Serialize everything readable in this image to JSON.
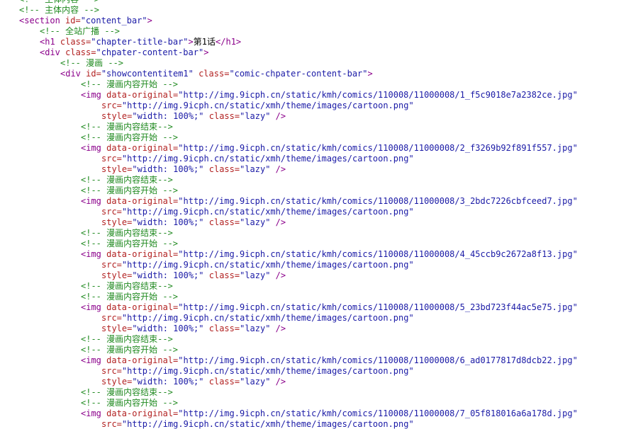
{
  "colors": {
    "comment": "#228b22",
    "tag": "#8b008b",
    "attribute": "#b22222",
    "value": "#1a1aa6",
    "text": "#000000",
    "background": "#ffffff"
  },
  "lines": [
    {
      "indent": 1,
      "tokens": [
        {
          "k": "c",
          "s": "<!-- 主体内容 -->"
        }
      ]
    },
    {
      "indent": 1,
      "tokens": [
        {
          "k": "c",
          "s": "<!-- 主体内容 -->"
        }
      ]
    },
    {
      "indent": 1,
      "tokens": [
        {
          "k": "t",
          "s": "<section"
        },
        {
          "k": "a",
          "s": " id="
        },
        {
          "k": "v",
          "s": "\"content_bar\""
        },
        {
          "k": "t",
          "s": ">"
        }
      ]
    },
    {
      "indent": 2,
      "tokens": [
        {
          "k": "c",
          "s": "<!-- 全站广播 -->"
        }
      ]
    },
    {
      "indent": 2,
      "tokens": [
        {
          "k": "t",
          "s": "<h1"
        },
        {
          "k": "a",
          "s": " class="
        },
        {
          "k": "v",
          "s": "\"chapter-title-bar\""
        },
        {
          "k": "t",
          "s": ">"
        },
        {
          "k": "x",
          "s": "第1话"
        },
        {
          "k": "t",
          "s": "</h1>"
        }
      ]
    },
    {
      "indent": 2,
      "tokens": [
        {
          "k": "t",
          "s": "<div"
        },
        {
          "k": "a",
          "s": " class="
        },
        {
          "k": "v",
          "s": "\"chpater-content-bar\""
        },
        {
          "k": "t",
          "s": ">"
        }
      ]
    },
    {
      "indent": 3,
      "tokens": [
        {
          "k": "c",
          "s": "<!-- 漫画 -->"
        }
      ]
    },
    {
      "indent": 3,
      "tokens": [
        {
          "k": "t",
          "s": "<div"
        },
        {
          "k": "a",
          "s": " id="
        },
        {
          "k": "v",
          "s": "\"showcontentitem1\""
        },
        {
          "k": "a",
          "s": " class="
        },
        {
          "k": "v",
          "s": "\"comic-chpater-content-bar\""
        },
        {
          "k": "t",
          "s": ">"
        }
      ]
    },
    {
      "indent": 4,
      "tokens": [
        {
          "k": "c",
          "s": "<!-- 漫画内容开始 -->"
        }
      ]
    },
    {
      "indent": 4,
      "tokens": [
        {
          "k": "t",
          "s": "<img"
        },
        {
          "k": "a",
          "s": " data-original="
        },
        {
          "k": "v",
          "s": "\"http://img.9icph.cn/static/kmh/comics/110008/11000008/1_f5c9018e7a2382ce.jpg\""
        }
      ]
    },
    {
      "indent": 5,
      "tokens": [
        {
          "k": "a",
          "s": "src="
        },
        {
          "k": "v",
          "s": "\"http://img.9icph.cn/static/xmh/theme/images/cartoon.png\""
        }
      ]
    },
    {
      "indent": 5,
      "tokens": [
        {
          "k": "a",
          "s": "style="
        },
        {
          "k": "v",
          "s": "\"width: 100%;\""
        },
        {
          "k": "a",
          "s": " class="
        },
        {
          "k": "v",
          "s": "\"lazy\""
        },
        {
          "k": "t",
          "s": " />"
        }
      ]
    },
    {
      "indent": 4,
      "tokens": [
        {
          "k": "c",
          "s": "<!-- 漫画内容结束-->"
        }
      ]
    },
    {
      "indent": 4,
      "tokens": [
        {
          "k": "c",
          "s": "<!-- 漫画内容开始 -->"
        }
      ]
    },
    {
      "indent": 4,
      "tokens": [
        {
          "k": "t",
          "s": "<img"
        },
        {
          "k": "a",
          "s": " data-original="
        },
        {
          "k": "v",
          "s": "\"http://img.9icph.cn/static/kmh/comics/110008/11000008/2_f3269b92f891f557.jpg\""
        }
      ]
    },
    {
      "indent": 5,
      "tokens": [
        {
          "k": "a",
          "s": "src="
        },
        {
          "k": "v",
          "s": "\"http://img.9icph.cn/static/xmh/theme/images/cartoon.png\""
        }
      ]
    },
    {
      "indent": 5,
      "tokens": [
        {
          "k": "a",
          "s": "style="
        },
        {
          "k": "v",
          "s": "\"width: 100%;\""
        },
        {
          "k": "a",
          "s": " class="
        },
        {
          "k": "v",
          "s": "\"lazy\""
        },
        {
          "k": "t",
          "s": " />"
        }
      ]
    },
    {
      "indent": 4,
      "tokens": [
        {
          "k": "c",
          "s": "<!-- 漫画内容结束-->"
        }
      ]
    },
    {
      "indent": 4,
      "tokens": [
        {
          "k": "c",
          "s": "<!-- 漫画内容开始 -->"
        }
      ]
    },
    {
      "indent": 4,
      "tokens": [
        {
          "k": "t",
          "s": "<img"
        },
        {
          "k": "a",
          "s": " data-original="
        },
        {
          "k": "v",
          "s": "\"http://img.9icph.cn/static/kmh/comics/110008/11000008/3_2bdc7226cbfceed7.jpg\""
        }
      ]
    },
    {
      "indent": 5,
      "tokens": [
        {
          "k": "a",
          "s": "src="
        },
        {
          "k": "v",
          "s": "\"http://img.9icph.cn/static/xmh/theme/images/cartoon.png\""
        }
      ]
    },
    {
      "indent": 5,
      "tokens": [
        {
          "k": "a",
          "s": "style="
        },
        {
          "k": "v",
          "s": "\"width: 100%;\""
        },
        {
          "k": "a",
          "s": " class="
        },
        {
          "k": "v",
          "s": "\"lazy\""
        },
        {
          "k": "t",
          "s": " />"
        }
      ]
    },
    {
      "indent": 4,
      "tokens": [
        {
          "k": "c",
          "s": "<!-- 漫画内容结束-->"
        }
      ]
    },
    {
      "indent": 4,
      "tokens": [
        {
          "k": "c",
          "s": "<!-- 漫画内容开始 -->"
        }
      ]
    },
    {
      "indent": 4,
      "tokens": [
        {
          "k": "t",
          "s": "<img"
        },
        {
          "k": "a",
          "s": " data-original="
        },
        {
          "k": "v",
          "s": "\"http://img.9icph.cn/static/kmh/comics/110008/11000008/4_45ccb9c2672a8f13.jpg\""
        }
      ]
    },
    {
      "indent": 5,
      "tokens": [
        {
          "k": "a",
          "s": "src="
        },
        {
          "k": "v",
          "s": "\"http://img.9icph.cn/static/xmh/theme/images/cartoon.png\""
        }
      ]
    },
    {
      "indent": 5,
      "tokens": [
        {
          "k": "a",
          "s": "style="
        },
        {
          "k": "v",
          "s": "\"width: 100%;\""
        },
        {
          "k": "a",
          "s": " class="
        },
        {
          "k": "v",
          "s": "\"lazy\""
        },
        {
          "k": "t",
          "s": " />"
        }
      ]
    },
    {
      "indent": 4,
      "tokens": [
        {
          "k": "c",
          "s": "<!-- 漫画内容结束-->"
        }
      ]
    },
    {
      "indent": 4,
      "tokens": [
        {
          "k": "c",
          "s": "<!-- 漫画内容开始 -->"
        }
      ]
    },
    {
      "indent": 4,
      "tokens": [
        {
          "k": "t",
          "s": "<img"
        },
        {
          "k": "a",
          "s": " data-original="
        },
        {
          "k": "v",
          "s": "\"http://img.9icph.cn/static/kmh/comics/110008/11000008/5_23bd723f44ac5e75.jpg\""
        }
      ]
    },
    {
      "indent": 5,
      "tokens": [
        {
          "k": "a",
          "s": "src="
        },
        {
          "k": "v",
          "s": "\"http://img.9icph.cn/static/xmh/theme/images/cartoon.png\""
        }
      ]
    },
    {
      "indent": 5,
      "tokens": [
        {
          "k": "a",
          "s": "style="
        },
        {
          "k": "v",
          "s": "\"width: 100%;\""
        },
        {
          "k": "a",
          "s": " class="
        },
        {
          "k": "v",
          "s": "\"lazy\""
        },
        {
          "k": "t",
          "s": " />"
        }
      ]
    },
    {
      "indent": 4,
      "tokens": [
        {
          "k": "c",
          "s": "<!-- 漫画内容结束-->"
        }
      ]
    },
    {
      "indent": 4,
      "tokens": [
        {
          "k": "c",
          "s": "<!-- 漫画内容开始 -->"
        }
      ]
    },
    {
      "indent": 4,
      "tokens": [
        {
          "k": "t",
          "s": "<img"
        },
        {
          "k": "a",
          "s": " data-original="
        },
        {
          "k": "v",
          "s": "\"http://img.9icph.cn/static/kmh/comics/110008/11000008/6_ad0177817d8dcb22.jpg\""
        }
      ]
    },
    {
      "indent": 5,
      "tokens": [
        {
          "k": "a",
          "s": "src="
        },
        {
          "k": "v",
          "s": "\"http://img.9icph.cn/static/xmh/theme/images/cartoon.png\""
        }
      ]
    },
    {
      "indent": 5,
      "tokens": [
        {
          "k": "a",
          "s": "style="
        },
        {
          "k": "v",
          "s": "\"width: 100%;\""
        },
        {
          "k": "a",
          "s": " class="
        },
        {
          "k": "v",
          "s": "\"lazy\""
        },
        {
          "k": "t",
          "s": " />"
        }
      ]
    },
    {
      "indent": 4,
      "tokens": [
        {
          "k": "c",
          "s": "<!-- 漫画内容结束-->"
        }
      ]
    },
    {
      "indent": 4,
      "tokens": [
        {
          "k": "c",
          "s": "<!-- 漫画内容开始 -->"
        }
      ]
    },
    {
      "indent": 4,
      "tokens": [
        {
          "k": "t",
          "s": "<img"
        },
        {
          "k": "a",
          "s": " data-original="
        },
        {
          "k": "v",
          "s": "\"http://img.9icph.cn/static/kmh/comics/110008/11000008/7_05f818016a6a178d.jpg\""
        }
      ]
    },
    {
      "indent": 5,
      "tokens": [
        {
          "k": "a",
          "s": "src="
        },
        {
          "k": "v",
          "s": "\"http://img.9icph.cn/static/xmh/theme/images/cartoon.png\""
        }
      ]
    }
  ]
}
